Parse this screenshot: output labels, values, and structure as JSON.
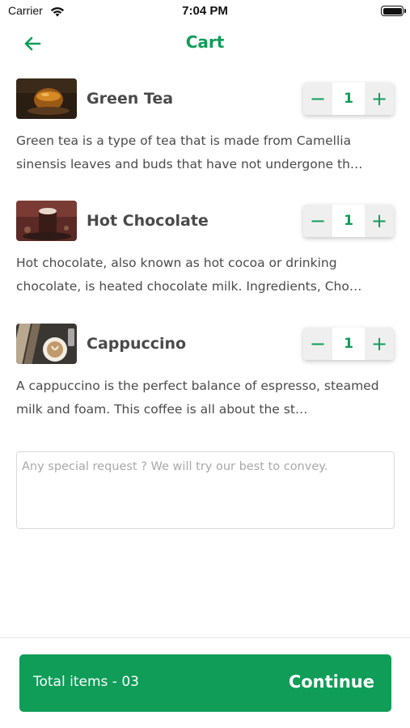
{
  "status_bar": {
    "carrier": "Carrier",
    "time": "7:04 PM"
  },
  "header": {
    "title": "Cart",
    "back_icon": "arrow-left-icon"
  },
  "colors": {
    "accent": "#0f9d58",
    "text": "#4a4a4a",
    "stepper_bg": "#efefef"
  },
  "cart": {
    "items": [
      {
        "name": "Green Tea",
        "quantity": "1",
        "description": "Green tea is a type of tea that is made from Camellia sinensis leaves and buds that have not undergone th…"
      },
      {
        "name": "Hot Chocolate",
        "quantity": "1",
        "description": "Hot chocolate, also known as hot cocoa or drinking chocolate, is heated chocolate milk. Ingredients, Cho…"
      },
      {
        "name": "Cappuccino",
        "quantity": "1",
        "description": "A cappuccino is the perfect balance of espresso, steamed milk and foam. This coffee is all about the st…"
      }
    ],
    "minus_label": "−",
    "plus_label": "+"
  },
  "request": {
    "placeholder": "Any special request ? We will try our best to convey.",
    "value": ""
  },
  "footer": {
    "total_items": "Total items - 03",
    "continue_label": "Continue"
  }
}
